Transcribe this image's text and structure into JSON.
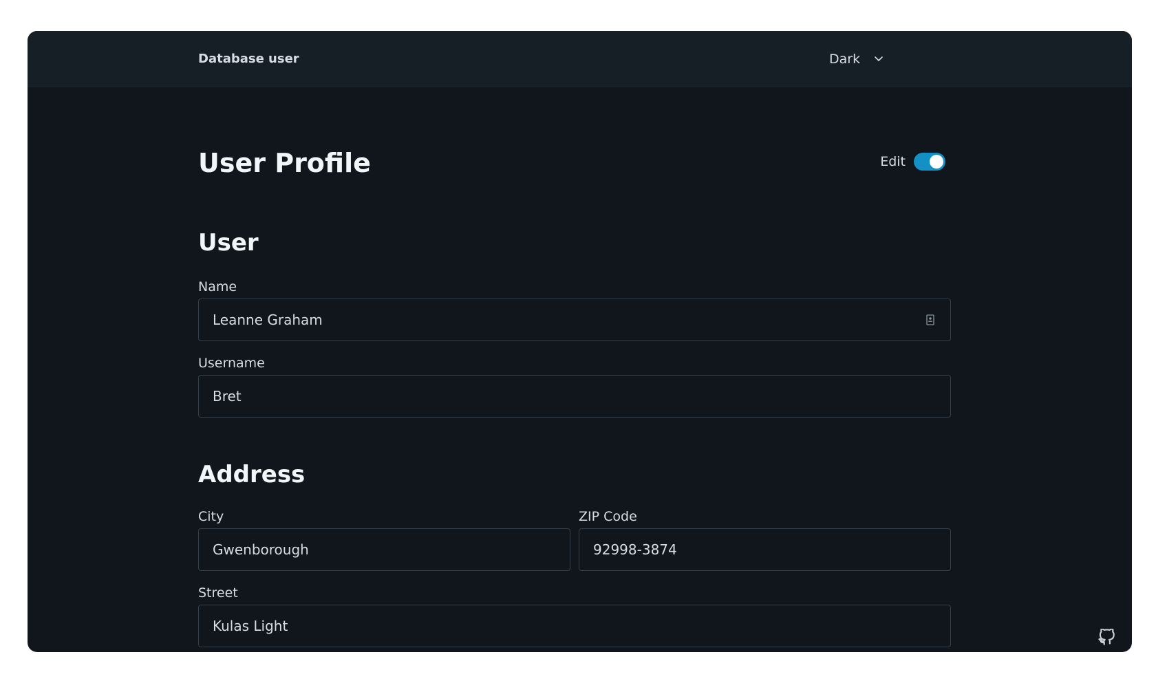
{
  "header": {
    "title": "Database user",
    "theme_selected": "Dark"
  },
  "page": {
    "title": "User Profile",
    "edit_label": "Edit",
    "edit_enabled": true
  },
  "user_section": {
    "title": "User",
    "name_label": "Name",
    "name_value": "Leanne Graham",
    "username_label": "Username",
    "username_value": "Bret"
  },
  "address_section": {
    "title": "Address",
    "city_label": "City",
    "city_value": "Gwenborough",
    "zip_label": "ZIP Code",
    "zip_value": "92998-3874",
    "street_label": "Street",
    "street_value": "Kulas Light"
  },
  "icons": {
    "theme_dropdown": "chevron-down-icon",
    "name_field": "contact-card-icon",
    "footer": "github-icon"
  },
  "colors": {
    "accent": "#1390c4",
    "background": "#11161c",
    "header_background": "#161e26"
  }
}
